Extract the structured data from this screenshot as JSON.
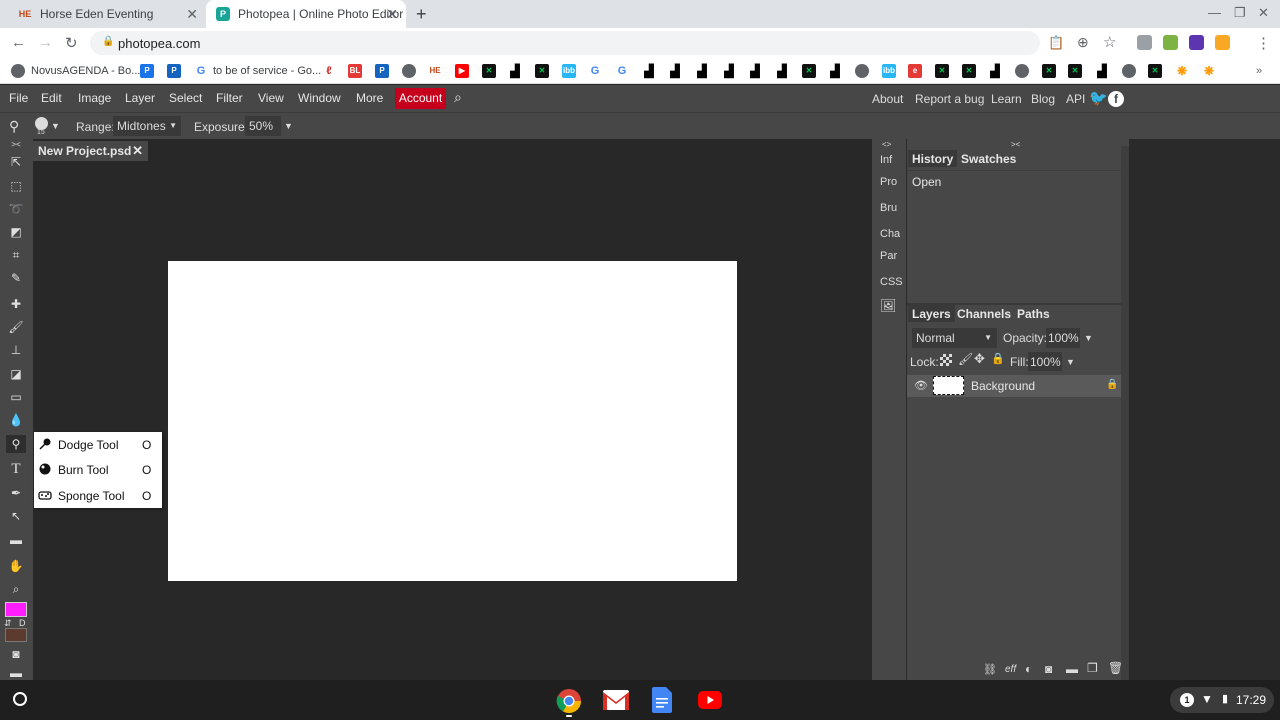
{
  "browser": {
    "tabs": [
      {
        "title": "Horse Eden Eventing",
        "favicon": "HE"
      },
      {
        "title": "Photopea | Online Photo Editor"
      }
    ],
    "url": "photopea.com",
    "bookmarks": [
      {
        "label": "NovusAGENDA - Bo..."
      },
      {
        "label": "to be of service - Go..."
      }
    ]
  },
  "menus": [
    "File",
    "Edit",
    "Image",
    "Layer",
    "Select",
    "Filter",
    "View",
    "Window",
    "More"
  ],
  "account_label": "Account",
  "right_links": [
    "About",
    "Report a bug",
    "Learn",
    "Blog",
    "API"
  ],
  "options": {
    "brush_size": "15",
    "range_label": "Range:",
    "range_value": "Midtones",
    "exposure_label": "Exposure:",
    "exposure_value": "50%"
  },
  "document": {
    "tab_title": "New Project.psd"
  },
  "tool_flyout": [
    {
      "label": "Dodge Tool",
      "key": "O"
    },
    {
      "label": "Burn Tool",
      "key": "O"
    },
    {
      "label": "Sponge Tool",
      "key": "O"
    }
  ],
  "colors": {
    "foreground": "#ff1dff",
    "background": "#5c3a2e",
    "accent": "#c6001c"
  },
  "collapsed_panels": [
    "Inf",
    "Pro",
    "Bru",
    "Cha",
    "Par",
    "CSS"
  ],
  "history_panel": {
    "tabs": [
      "History",
      "Swatches"
    ],
    "items": [
      "Open"
    ]
  },
  "layers_panel": {
    "tabs": [
      "Layers",
      "Channels",
      "Paths"
    ],
    "blend_mode": "Normal",
    "opacity_label": "Opacity:",
    "opacity_value": "100%",
    "lock_label": "Lock:",
    "fill_label": "Fill:",
    "fill_value": "100%",
    "layers": [
      {
        "name": "Background"
      }
    ],
    "footer_eff": "eff"
  },
  "toolbar_fg_bg_label": "D",
  "system": {
    "time": "17:29",
    "notifications": "1"
  }
}
